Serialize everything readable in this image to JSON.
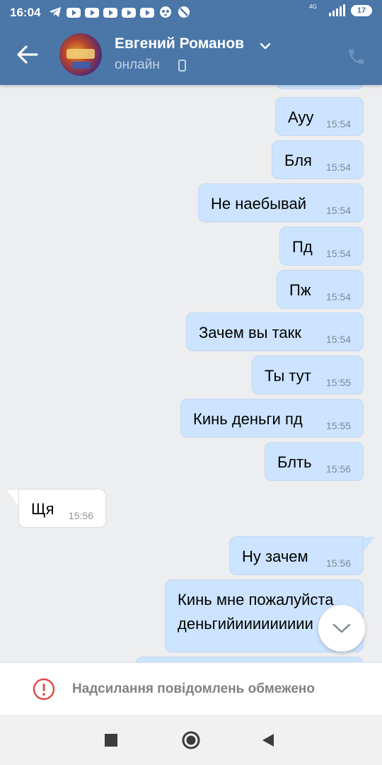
{
  "statusbar": {
    "time": "16:04",
    "network": "4G",
    "battery": "17",
    "notification_icons": [
      "telegram-icon",
      "youtube-icon",
      "youtube-icon",
      "youtube-icon",
      "youtube-icon",
      "youtube-icon",
      "panda-icon",
      "blocked-icon"
    ]
  },
  "header": {
    "name": "Евгений Романов",
    "status": "онлайн",
    "accent": "#4a76a8"
  },
  "messages": [
    {
      "text": "Ауу",
      "time": "15:54",
      "direction": "out"
    },
    {
      "text": "Бля",
      "time": "15:54",
      "direction": "out"
    },
    {
      "text": "Не наебывай",
      "time": "15:54",
      "direction": "out"
    },
    {
      "text": "Пд",
      "time": "15:54",
      "direction": "out"
    },
    {
      "text": "Пж",
      "time": "15:54",
      "direction": "out"
    },
    {
      "text": "Зачем вы такк",
      "time": "15:54",
      "direction": "out"
    },
    {
      "text": "Ты тут",
      "time": "15:55",
      "direction": "out"
    },
    {
      "text": "Кинь деньги пд",
      "time": "15:55",
      "direction": "out"
    },
    {
      "text": "Блть",
      "time": "15:56",
      "direction": "out"
    },
    {
      "text": "Щя",
      "time": "15:56",
      "direction": "in"
    },
    {
      "text": "Ну зачем",
      "time": "15:56",
      "direction": "out"
    },
    {
      "text_line1": "Кинь мне пожалуйста",
      "text_line2": "деньгийиииииииии",
      "direction": "out"
    }
  ],
  "restriction": {
    "text": "Надсилання повідомлень обмежено"
  }
}
